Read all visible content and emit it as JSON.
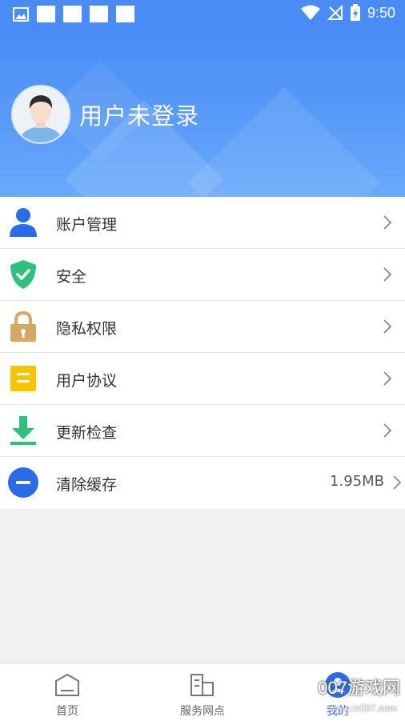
{
  "status_bar": {
    "time": "9:50"
  },
  "profile": {
    "username": "用户未登录"
  },
  "menu": [
    {
      "label": "账户管理",
      "icon": "user-icon",
      "value": ""
    },
    {
      "label": "安全",
      "icon": "shield-check-icon",
      "value": ""
    },
    {
      "label": "隐私权限",
      "icon": "lock-icon",
      "value": ""
    },
    {
      "label": "用户协议",
      "icon": "document-icon",
      "value": ""
    },
    {
      "label": "更新检查",
      "icon": "download-icon",
      "value": ""
    },
    {
      "label": "清除缓存",
      "icon": "minus-circle-icon",
      "value": "1.95MB"
    }
  ],
  "bottom_nav": [
    {
      "label": "首页",
      "icon": "home-icon"
    },
    {
      "label": "服务网点",
      "icon": "building-icon"
    },
    {
      "label": "我的",
      "icon": "profile-icon"
    }
  ],
  "watermark": {
    "text": "007游戏网",
    "sub": "www.cr007.com"
  },
  "colors": {
    "primary": "#4a8cf5",
    "user": "#2a6be8",
    "shield": "#2fc07e",
    "lock": "#d7a764",
    "doc": "#f7c400",
    "download": "#2fc07e",
    "clear": "#2a6be8"
  }
}
